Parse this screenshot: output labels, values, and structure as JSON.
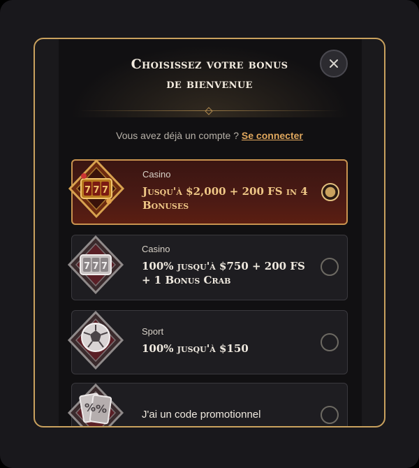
{
  "modal": {
    "title_line1": "Choisissez votre bonus",
    "title_line2": "de bienvenue"
  },
  "account": {
    "prompt": "Vous avez déjà un compte ?",
    "login_link": "Se connecter"
  },
  "bonuses": [
    {
      "category": "Casino",
      "title": "Jusqu'à $2,000 + 200 FS in 4 Bonuses",
      "selected": true,
      "icon": "slot-777-icon"
    },
    {
      "category": "Casino",
      "title": "100% jusqu'à $750 + 200 FS + 1 Bonus Crab",
      "selected": false,
      "icon": "slot-777-icon"
    },
    {
      "category": "Sport",
      "title": "100% jusqu'à $150",
      "selected": false,
      "icon": "soccer-ball-icon"
    },
    {
      "category": "",
      "title": "J'ai un code promotionnel",
      "selected": false,
      "icon": "promo-code-icon"
    }
  ],
  "colors": {
    "accent_gold": "#c9a15e",
    "selected_card_bg": "#4a1a14",
    "link": "#e1a85e"
  }
}
